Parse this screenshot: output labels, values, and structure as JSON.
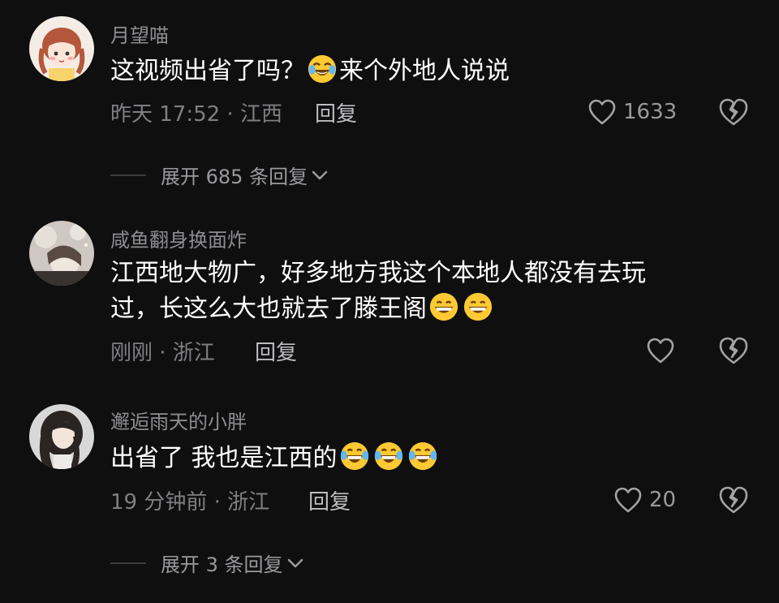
{
  "comments": [
    {
      "username": "月望喵",
      "text_before": "这视频出省了吗？",
      "emoji_1": "crying-laughing-emoji",
      "text_after": "来个外地人说说",
      "meta": "昨天 17:52 · 江西",
      "reply": "回复",
      "likes": "1633",
      "expand": "展开 685 条回复"
    },
    {
      "username": "咸鱼翻身换面炸",
      "line1": "江西地大物广，好多地方我这个本地人都没有去玩",
      "line2": "过，长这么大也就去了滕王阁",
      "emoji": "grinning-emoji",
      "meta": "刚刚 · 浙江",
      "reply": "回复",
      "likes": ""
    },
    {
      "username": "邂逅雨天的小胖",
      "text": "出省了 我也是江西的",
      "emoji": "rolling-laughing-emoji",
      "meta": "19 分钟前 · 浙江",
      "reply": "回复",
      "likes": "20",
      "expand": "展开 3 条回复"
    }
  ],
  "colors": {
    "background": "#0f0f10",
    "text": "#ffffff",
    "muted": "#8d8d90"
  }
}
